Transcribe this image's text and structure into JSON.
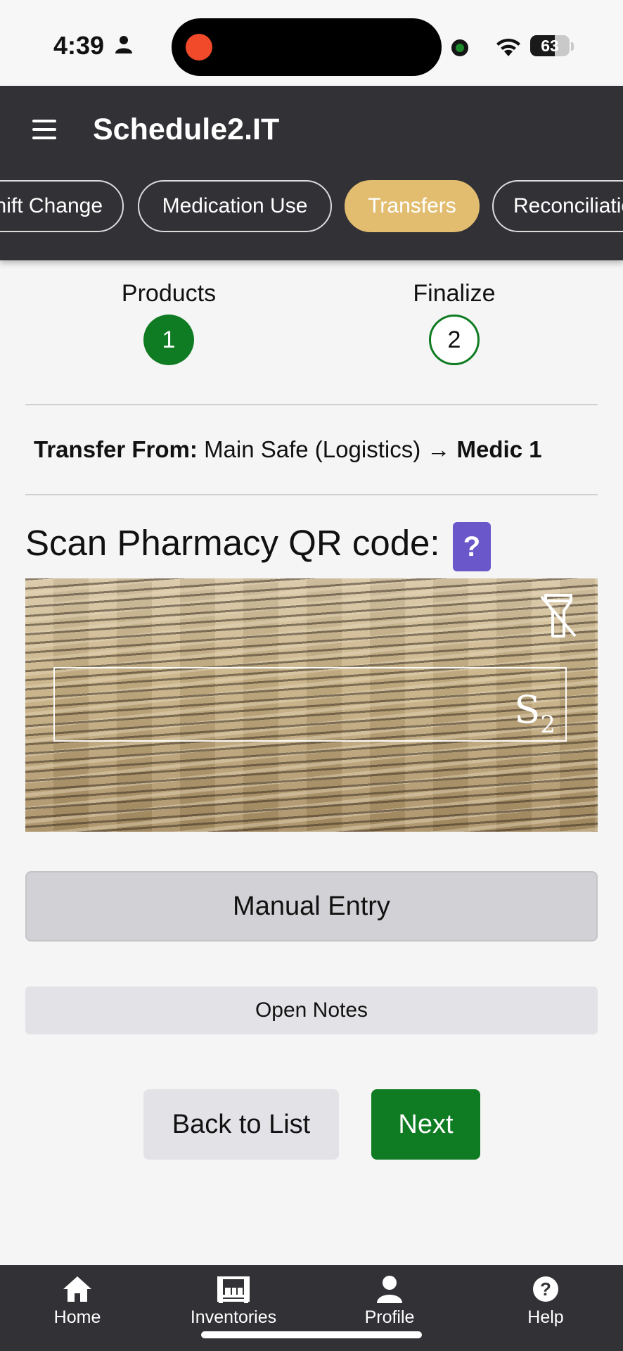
{
  "status_bar": {
    "time": "4:39",
    "battery_level": "63"
  },
  "header": {
    "app_title": "Schedule2.IT",
    "tabs": [
      {
        "label": "Shift Change"
      },
      {
        "label": "Medication Use"
      },
      {
        "label": "Transfers",
        "active": true
      },
      {
        "label": "Reconciliation"
      }
    ]
  },
  "stepper": {
    "steps": [
      {
        "label": "Products",
        "number": "1"
      },
      {
        "label": "Finalize",
        "number": "2"
      }
    ]
  },
  "transfer": {
    "label": "Transfer From:",
    "source": "Main Safe (Logistics)",
    "arrow": "→",
    "destination": "Medic 1"
  },
  "scan": {
    "title": "Scan Pharmacy QR code:",
    "help_symbol": "?"
  },
  "buttons": {
    "manual_entry": "Manual Entry",
    "open_notes": "Open Notes",
    "back_to_list": "Back to List",
    "next": "Next"
  },
  "bottom_nav": {
    "items": [
      {
        "label": "Home",
        "icon": "home-icon"
      },
      {
        "label": "Inventories",
        "icon": "inventories-icon"
      },
      {
        "label": "Profile",
        "icon": "profile-icon"
      },
      {
        "label": "Help",
        "icon": "help-icon"
      }
    ]
  },
  "colors": {
    "header_bg": "#323135",
    "active_tab": "#e2bd70",
    "primary_green": "#0f7b22",
    "help_purple": "#6a57c9"
  }
}
